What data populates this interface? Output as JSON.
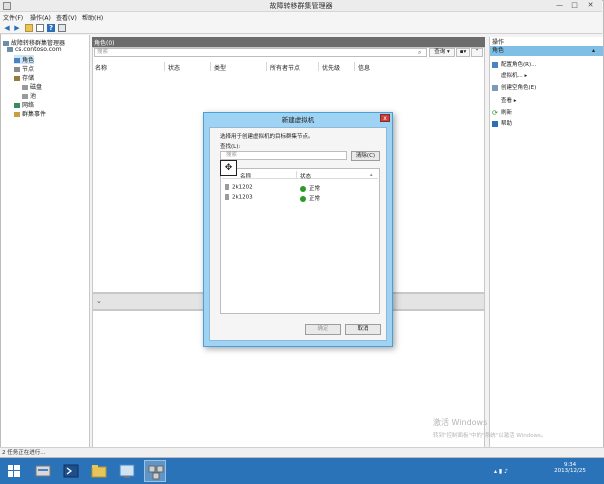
{
  "window": {
    "title": "故障转移群集管理器",
    "controls": {
      "minimize": "—",
      "maximize": "□",
      "close": "✕"
    }
  },
  "menu": {
    "items": [
      "文件(F)",
      "操作(A)",
      "查看(V)",
      "帮助(H)"
    ]
  },
  "toolbar": {
    "icons": [
      "back-arrow-icon",
      "forward-arrow-icon",
      "folder-icon",
      "properties-icon",
      "help-icon",
      "console-icon"
    ]
  },
  "tree": {
    "root": "故障转移群集管理器",
    "cluster": "cs.contoso.com",
    "roles": "角色",
    "nodes": "节点",
    "storage": "存储",
    "disks": "磁盘",
    "pools": "池",
    "networks": "网络",
    "events": "群集事件"
  },
  "center": {
    "header": "角色(0)",
    "search_placeholder": "搜索",
    "query_label": "查询",
    "columns": [
      "名称",
      "状态",
      "类型",
      "所有者节点",
      "优先级",
      "信息"
    ]
  },
  "actions": {
    "title": "操作",
    "section": "角色",
    "items": [
      "配置角色(R)...",
      "虚拟机...",
      "创建空角色(E)",
      "查看",
      "刷新",
      "帮助"
    ]
  },
  "dialog": {
    "title": "新建虚拟机",
    "close": "x",
    "instruction": "选择用于创建虚拟机的目标群集节点。",
    "search_label": "查找(L):",
    "search_placeholder": "搜索",
    "clear_button": "清除(C)",
    "col_name": "名称",
    "col_status": "状态",
    "rows": [
      {
        "name": "2k1202",
        "status": "正常"
      },
      {
        "name": "2k1203",
        "status": "正常"
      }
    ],
    "ok_button": "确定",
    "cancel_button": "取消"
  },
  "statusbar": {
    "text": "2 任务正在进行..."
  },
  "watermark": {
    "line1": "激活 Windows",
    "line2": "转到\"控制面板\"中的\"系统\"以激活 Windows。"
  },
  "taskbar": {
    "time": "9:34",
    "date": "2013/12/25"
  },
  "colors": {
    "taskbar": "#2a73b8",
    "dialog_frame": "#9ed3f3",
    "action_highlight": "#7fbfe6",
    "center_header": "#6c6c6c"
  }
}
